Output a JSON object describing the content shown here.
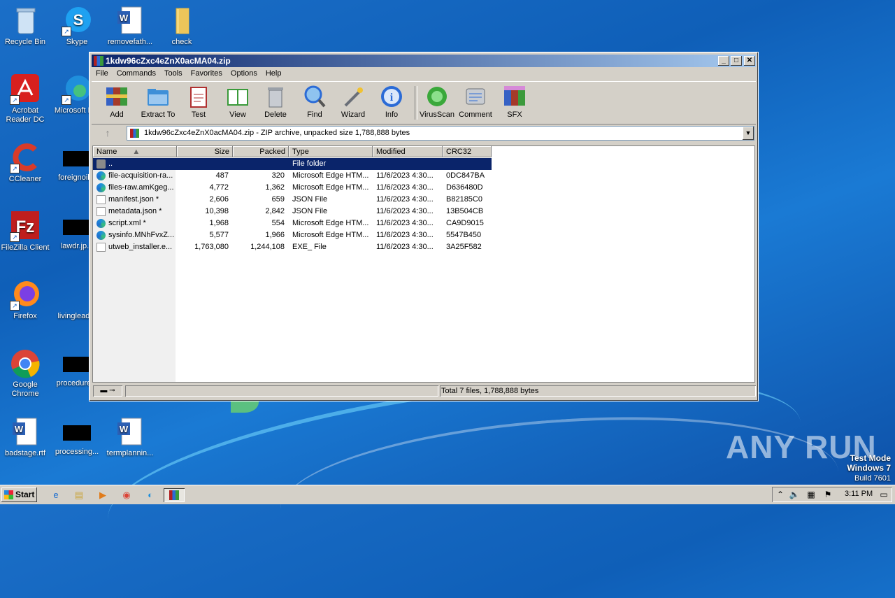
{
  "desktop": {
    "icons": [
      {
        "label": "Recycle Bin"
      },
      {
        "label": "Skype"
      },
      {
        "label": "removefath..."
      },
      {
        "label": "check"
      },
      {
        "label": "Acrobat Reader DC"
      },
      {
        "label": "Microsoft E..."
      },
      {
        "label": "CCleaner"
      },
      {
        "label": "foreignoil..."
      },
      {
        "label": "FileZilla Client"
      },
      {
        "label": "lawdr.jp..."
      },
      {
        "label": "Firefox"
      },
      {
        "label": "livinglead..."
      },
      {
        "label": "Google Chrome"
      },
      {
        "label": "procedure..."
      },
      {
        "label": "badstage.rtf"
      },
      {
        "label": "processing..."
      },
      {
        "label": "termplannin..."
      }
    ]
  },
  "window": {
    "title": "1kdw96cZxc4eZnX0acMA04.zip",
    "menu": [
      "File",
      "Commands",
      "Tools",
      "Favorites",
      "Options",
      "Help"
    ],
    "toolbar": [
      "Add",
      "Extract To",
      "Test",
      "View",
      "Delete",
      "Find",
      "Wizard",
      "Info",
      "VirusScan",
      "Comment",
      "SFX"
    ],
    "address": "1kdw96cZxc4eZnX0acMA04.zip - ZIP archive, unpacked size 1,788,888 bytes",
    "columns": [
      "Name",
      "Size",
      "Packed",
      "Type",
      "Modified",
      "CRC32"
    ],
    "rows": [
      {
        "name": "..",
        "size": "",
        "packed": "",
        "type": "File folder",
        "modified": "",
        "crc": "",
        "icon": "folder-icon"
      },
      {
        "name": "file-acquisition-ra...",
        "size": "487",
        "packed": "320",
        "type": "Microsoft Edge HTM...",
        "modified": "11/6/2023 4:30...",
        "crc": "0DC847BA",
        "icon": "edge-file-icon"
      },
      {
        "name": "files-raw.amKgeg...",
        "size": "4,772",
        "packed": "1,362",
        "type": "Microsoft Edge HTM...",
        "modified": "11/6/2023 4:30...",
        "crc": "D636480D",
        "icon": "edge-file-icon"
      },
      {
        "name": "manifest.json *",
        "size": "2,606",
        "packed": "659",
        "type": "JSON File",
        "modified": "11/6/2023 4:30...",
        "crc": "B82185C0",
        "icon": "document-icon"
      },
      {
        "name": "metadata.json *",
        "size": "10,398",
        "packed": "2,842",
        "type": "JSON File",
        "modified": "11/6/2023 4:30...",
        "crc": "13B504CB",
        "icon": "document-icon"
      },
      {
        "name": "script.xml *",
        "size": "1,968",
        "packed": "554",
        "type": "Microsoft Edge HTM...",
        "modified": "11/6/2023 4:30...",
        "crc": "CA9D9015",
        "icon": "edge-file-icon"
      },
      {
        "name": "sysinfo.MNhFvxZ...",
        "size": "5,577",
        "packed": "1,966",
        "type": "Microsoft Edge HTM...",
        "modified": "11/6/2023 4:30...",
        "crc": "5547B450",
        "icon": "edge-file-icon"
      },
      {
        "name": "utweb_installer.e...",
        "size": "1,763,080",
        "packed": "1,244,108",
        "type": "EXE_ File",
        "modified": "11/6/2023 4:30...",
        "crc": "3A25F582",
        "icon": "document-icon"
      }
    ],
    "status_total": "Total 7 files, 1,788,888 bytes"
  },
  "taskbar": {
    "start_label": "Start",
    "clock": "3:11 PM"
  },
  "watermark": {
    "line1": "Test Mode",
    "line2": "Windows 7",
    "line3": "Build 7601",
    "brand": "ANY RUN"
  }
}
